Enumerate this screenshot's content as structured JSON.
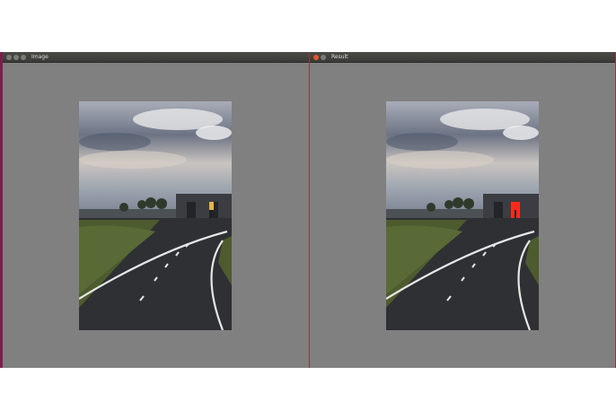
{
  "windows": [
    {
      "title": "Image",
      "side": "left",
      "light_color": "#e8b24a"
    },
    {
      "title": "Result",
      "side": "right",
      "light_color": "#ff2a1a"
    }
  ],
  "colors": {
    "canvas": "#808080",
    "titlebar": "#3f3f3b",
    "left_frame": "#7a1f4a",
    "right_frame": "#8a3a3a"
  }
}
